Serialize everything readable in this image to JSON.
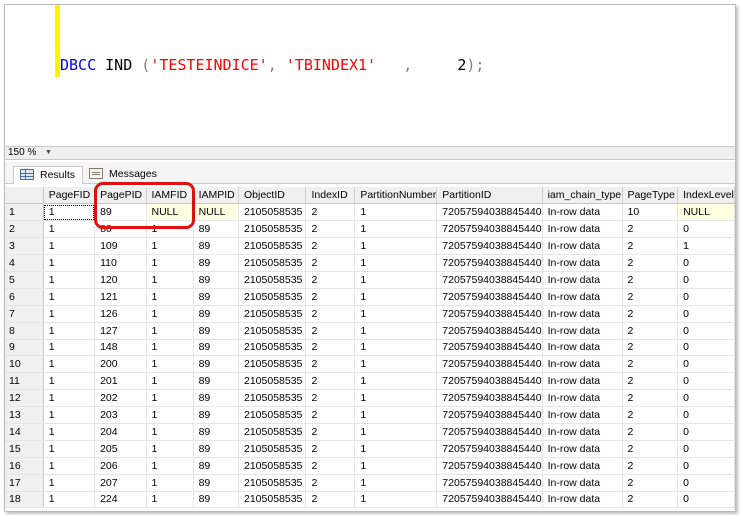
{
  "editor": {
    "keyword": "DBCC",
    "command": "IND",
    "open_paren": "(",
    "arg1": "'TESTEINDICE'",
    "comma1": ",",
    "arg2": "'TBINDEX1'",
    "comma2": ",",
    "arg3": "2",
    "close": ");"
  },
  "zoom": {
    "value": "150 %"
  },
  "tabs": {
    "results": "Results",
    "messages": "Messages"
  },
  "grid": {
    "columns": [
      "PageFID",
      "PagePID",
      "IAMFID",
      "IAMPID",
      "ObjectID",
      "IndexID",
      "PartitionNumber",
      "PartitionID",
      "iam_chain_type",
      "PageType",
      "IndexLevel"
    ],
    "rows": [
      [
        "1",
        "1",
        "89",
        "NULL",
        "NULL",
        "2105058535",
        "2",
        "1",
        "72057594038845440",
        "In-row data",
        "10",
        "NULL"
      ],
      [
        "2",
        "1",
        "80",
        "1",
        "89",
        "2105058535",
        "2",
        "1",
        "72057594038845440",
        "In-row data",
        "2",
        "0"
      ],
      [
        "3",
        "1",
        "109",
        "1",
        "89",
        "2105058535",
        "2",
        "1",
        "72057594038845440",
        "In-row data",
        "2",
        "1"
      ],
      [
        "4",
        "1",
        "110",
        "1",
        "89",
        "2105058535",
        "2",
        "1",
        "72057594038845440",
        "In-row data",
        "2",
        "0"
      ],
      [
        "5",
        "1",
        "120",
        "1",
        "89",
        "2105058535",
        "2",
        "1",
        "72057594038845440",
        "In-row data",
        "2",
        "0"
      ],
      [
        "6",
        "1",
        "121",
        "1",
        "89",
        "2105058535",
        "2",
        "1",
        "72057594038845440",
        "In-row data",
        "2",
        "0"
      ],
      [
        "7",
        "1",
        "126",
        "1",
        "89",
        "2105058535",
        "2",
        "1",
        "72057594038845440",
        "In-row data",
        "2",
        "0"
      ],
      [
        "8",
        "1",
        "127",
        "1",
        "89",
        "2105058535",
        "2",
        "1",
        "72057594038845440",
        "In-row data",
        "2",
        "0"
      ],
      [
        "9",
        "1",
        "148",
        "1",
        "89",
        "2105058535",
        "2",
        "1",
        "72057594038845440",
        "In-row data",
        "2",
        "0"
      ],
      [
        "10",
        "1",
        "200",
        "1",
        "89",
        "2105058535",
        "2",
        "1",
        "72057594038845440",
        "In-row data",
        "2",
        "0"
      ],
      [
        "11",
        "1",
        "201",
        "1",
        "89",
        "2105058535",
        "2",
        "1",
        "72057594038845440",
        "In-row data",
        "2",
        "0"
      ],
      [
        "12",
        "1",
        "202",
        "1",
        "89",
        "2105058535",
        "2",
        "1",
        "72057594038845440",
        "In-row data",
        "2",
        "0"
      ],
      [
        "13",
        "1",
        "203",
        "1",
        "89",
        "2105058535",
        "2",
        "1",
        "72057594038845440",
        "In-row data",
        "2",
        "0"
      ],
      [
        "14",
        "1",
        "204",
        "1",
        "89",
        "2105058535",
        "2",
        "1",
        "72057594038845440",
        "In-row data",
        "2",
        "0"
      ],
      [
        "15",
        "1",
        "205",
        "1",
        "89",
        "2105058535",
        "2",
        "1",
        "72057594038845440",
        "In-row data",
        "2",
        "0"
      ],
      [
        "16",
        "1",
        "206",
        "1",
        "89",
        "2105058535",
        "2",
        "1",
        "72057594038845440",
        "In-row data",
        "2",
        "0"
      ],
      [
        "17",
        "1",
        "207",
        "1",
        "89",
        "2105058535",
        "2",
        "1",
        "72057594038845440",
        "In-row data",
        "2",
        "0"
      ],
      [
        "18",
        "1",
        "224",
        "1",
        "89",
        "2105058535",
        "2",
        "1",
        "72057594038845440",
        "In-row data",
        "2",
        "0"
      ]
    ]
  },
  "colors": {
    "keyword": "#0000ff",
    "string": "#ff0000",
    "null_cell": "#ffffe1",
    "highlight": "#e01010",
    "current_line": "#fff200"
  }
}
